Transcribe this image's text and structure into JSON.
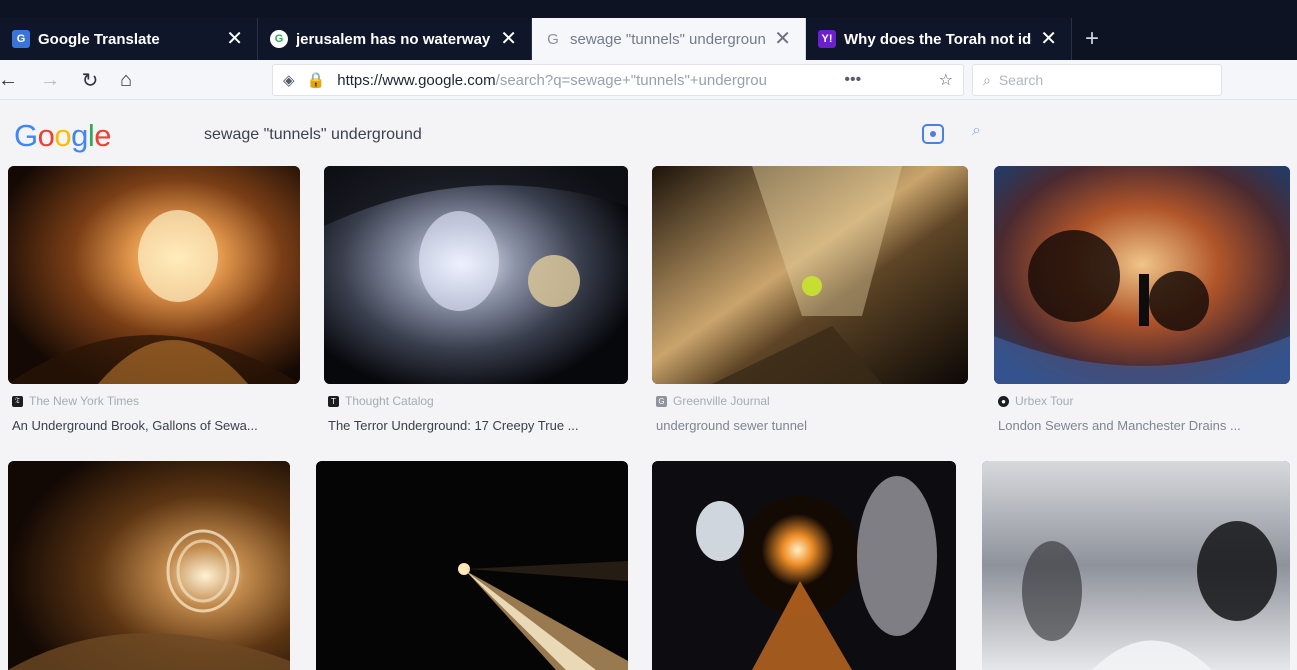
{
  "tabs": [
    {
      "title": "Google Translate",
      "favicon": "translate-icon",
      "active": false
    },
    {
      "title": "jerusalem has no waterway - Gc",
      "favicon": "google-icon",
      "active": false
    },
    {
      "title": "sewage \"tunnels\" undergroun",
      "favicon": "google-icon",
      "active": true
    },
    {
      "title": "Why does the Torah not identif",
      "favicon": "yahoo-icon",
      "active": false
    }
  ],
  "newtab_label": "+",
  "nav": {
    "url_domain": "https://www.google.com",
    "url_path": "/search?q=sewage+\"tunnels\"+undergrou",
    "overflow_label": "•••",
    "search_placeholder": "Search"
  },
  "google": {
    "logo_letters": [
      "G",
      "o",
      "o",
      "g",
      "l",
      "e"
    ],
    "query": "sewage \"tunnels\" underground"
  },
  "results": [
    {
      "source": "The New York Times",
      "title": "An Underground Brook, Gallons of Sewa..."
    },
    {
      "source": "Thought Catalog",
      "title": "The Terror Underground: 17 Creepy True ..."
    },
    {
      "source": "Greenville Journal",
      "title": "underground sewer tunnel"
    },
    {
      "source": "Urbex Tour",
      "title": "London Sewers and Manchester Drains ..."
    },
    {
      "source": "",
      "title": ""
    },
    {
      "source": "",
      "title": ""
    },
    {
      "source": "",
      "title": ""
    },
    {
      "source": "",
      "title": ""
    }
  ],
  "colors": {
    "tabbar": "#0e1324",
    "active_tab": "#f6f7fa",
    "google_blue": "#4285f4",
    "google_red": "#ea4335",
    "google_yellow": "#fbbc05",
    "google_green": "#34a853"
  }
}
